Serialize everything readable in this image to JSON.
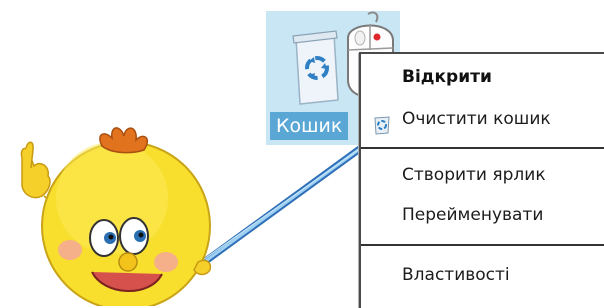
{
  "desktop_icon": {
    "label": "Кошик",
    "icon": "recycle-bin-icon",
    "highlight_color": "#5aa7d6"
  },
  "context_menu": {
    "items": [
      {
        "label": "Відкрити",
        "bold": true
      },
      {
        "label": "Очистити кошик",
        "icon": "recycle-bin-small-icon"
      },
      {
        "label": "Створити ярлик"
      },
      {
        "label": "Перейменувати"
      },
      {
        "label": "Властивості"
      }
    ]
  },
  "illustration": {
    "mascot": "yellow-ball-character",
    "pointer": "pointer-stick",
    "mouse": "computer-mouse-icon",
    "mouse_button_dot_color": "#e0262d"
  }
}
